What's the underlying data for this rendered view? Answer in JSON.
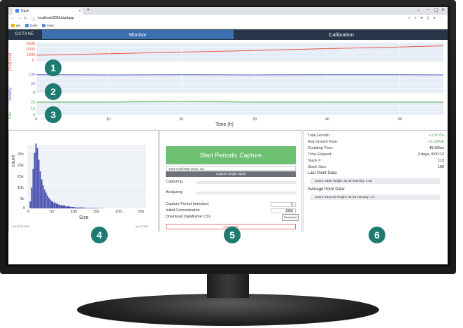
{
  "browser": {
    "tab_title": "Dash",
    "url": "localhost:8050/startupp",
    "bookmarks": [
      "pid",
      "Dash",
      "enlar"
    ]
  },
  "app": {
    "logo": "OCTANE",
    "tabs": [
      "Monitor",
      "Calibration"
    ]
  },
  "main_chart": {
    "y1_label": "[Cell] (nm)",
    "y2_label": "Visibility",
    "y3_label": "Size",
    "x_label": "Time (h)",
    "y1_ticks": [
      "3000",
      "2000",
      "1000",
      "0"
    ],
    "y2_ticks": [
      "100",
      "50",
      "0"
    ],
    "y3_ticks": [
      "20",
      "10",
      "0"
    ],
    "x_ticks": [
      "0",
      "10",
      "20",
      "30",
      "40",
      "50"
    ],
    "colors": {
      "cell": "#e8583f",
      "visibility": "#5b63c7",
      "size": "#4caf50",
      "bg": "#e6edf7"
    }
  },
  "chart_data": {
    "type": "line",
    "x_range": [
      0,
      56
    ],
    "series": [
      {
        "name": "[Cell] (nm)",
        "x": [
          0,
          10,
          20,
          30,
          40,
          50,
          56
        ],
        "values": [
          1000,
          1250,
          1500,
          1750,
          2050,
          2300,
          2500
        ]
      },
      {
        "name": "Visibility",
        "x": [
          0,
          10,
          20,
          30,
          40,
          50,
          56
        ],
        "values": [
          97,
          96,
          97,
          96,
          97,
          97,
          96
        ]
      },
      {
        "name": "Size",
        "x": [
          0,
          10,
          20,
          30,
          40,
          50,
          56
        ],
        "values": [
          20,
          20,
          21,
          20,
          20,
          20,
          20
        ]
      }
    ]
  },
  "histogram": {
    "y_label": "count",
    "x_label": "Size",
    "y_ticks": [
      "25k",
      "20k",
      "15k",
      "10k",
      "5k",
      "0"
    ],
    "x_ticks": [
      "0",
      "50",
      "100",
      "150",
      "200",
      "250"
    ],
    "footer_left": "Jan 15 10:00:00",
    "footer_right": "Jan 17 2022",
    "color": "#4b53b0"
  },
  "histogram_data": {
    "type": "bar",
    "x": [
      5,
      8,
      11,
      14,
      17,
      20,
      23,
      26,
      29,
      32,
      35,
      38,
      41,
      44,
      47,
      50,
      55,
      60,
      65,
      70,
      80,
      90,
      100,
      120,
      150
    ],
    "values": [
      3000,
      9000,
      17000,
      24000,
      28000,
      26000,
      21000,
      16000,
      12500,
      10000,
      8200,
      6800,
      5600,
      4600,
      3800,
      3100,
      2500,
      2000,
      1600,
      1300,
      900,
      600,
      400,
      200,
      100
    ]
  },
  "capture": {
    "start_label": "Start Periodic Capture",
    "next_scan": "Time Until Next Scan: n/a",
    "single_stack": "Capture Single Stack",
    "capturing_label": "Capturing",
    "analyzing_label": "Analyzing",
    "period_label": "Capture Period (minutes)",
    "period_value": "5",
    "concentration_label": "Initial Concentration",
    "concentration_value": "1000",
    "download_label": "Download Dataframe CSV",
    "download_button": "Download",
    "clear_label": "Clear Data"
  },
  "stats": {
    "rows": [
      {
        "label": "Total Growth:",
        "value": "+178.7%",
        "color": "#3aa14a"
      },
      {
        "label": "Avg Growth Rate:",
        "value": "+3.19%/h",
        "color": "#3aa14a"
      },
      {
        "label": "Doubling Time:",
        "value": "49.32hrs",
        "color": "#222222"
      },
      {
        "label": "Time Elapsed:",
        "value": "2 days, 8:00:12",
        "color": "#222222"
      },
      {
        "label": "Stack #:",
        "value": "113",
        "color": "#222222"
      },
      {
        "label": "Stack Size:",
        "value": "100",
        "color": "#222222"
      }
    ],
    "last_point_title": "Last Point Data:",
    "last_point": "Count: 3180    Height: 21.48    Intensity: 1.49",
    "avg_point_title": "Average Point Data:",
    "avg_point": "Count: 2122.03    Height: 22.49    Intensity: 1.4"
  },
  "badges": [
    "1",
    "2",
    "3",
    "4",
    "5",
    "6"
  ]
}
